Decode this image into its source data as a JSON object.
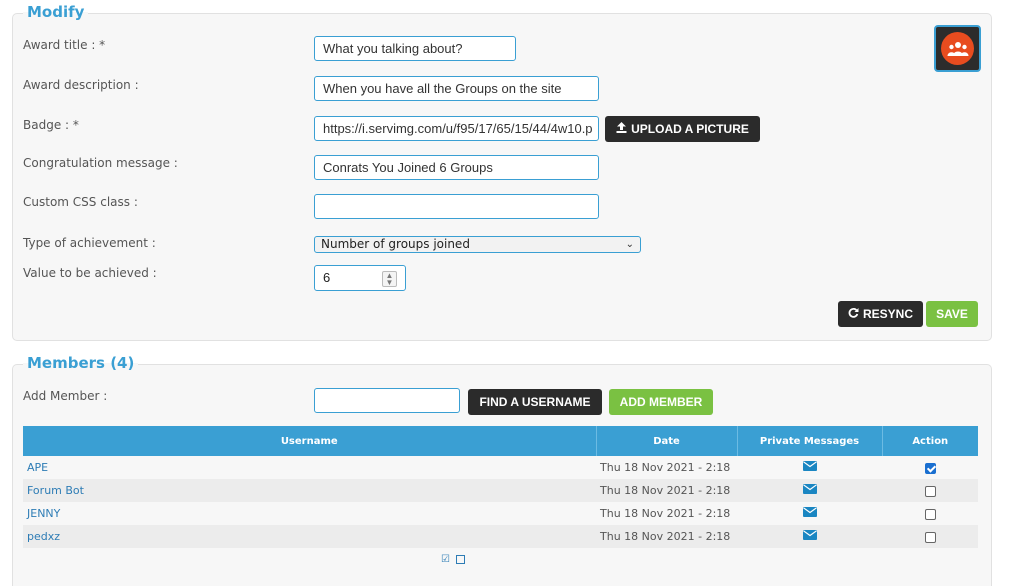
{
  "modify": {
    "legend": "Modify",
    "fields": {
      "award_title": {
        "label": "Award title : *",
        "value": "What you talking about?"
      },
      "award_description": {
        "label": "Award description :",
        "value": "When you have all the Groups on the site"
      },
      "badge": {
        "label": "Badge : *",
        "value": "https://i.servimg.com/u/f95/17/65/15/44/4w10.p"
      },
      "congratulation_message": {
        "label": "Congratulation message :",
        "value": "Conrats You Joined 6 Groups"
      },
      "custom_css_class": {
        "label": "Custom CSS class :",
        "value": ""
      },
      "type_of_achievement": {
        "label": "Type of achievement :",
        "value": "Number of groups joined"
      },
      "value_to_be_achieved": {
        "label": "Value to be achieved :",
        "value": "6"
      }
    },
    "upload_button": "UPLOAD A PICTURE",
    "resync_button": "RESYNC",
    "save_button": "SAVE",
    "badge_icon": "group-people-icon"
  },
  "members": {
    "legend": "Members (4)",
    "add_member_label": "Add Member :",
    "add_member_value": "",
    "find_username_button": "FIND A USERNAME",
    "add_member_button": "ADD MEMBER",
    "columns": {
      "username": "Username",
      "date": "Date",
      "private_messages": "Private Messages",
      "action": "Action"
    },
    "rows": [
      {
        "username": "APE",
        "date": "Thu 18 Nov 2021 - 2:18",
        "checked": true
      },
      {
        "username": "Forum Bot",
        "date": "Thu 18 Nov 2021 - 2:18",
        "checked": false
      },
      {
        "username": "JENNY",
        "date": "Thu 18 Nov 2021 - 2:18",
        "checked": false
      },
      {
        "username": "pedxz",
        "date": "Thu 18 Nov 2021 - 2:18",
        "checked": false
      }
    ],
    "pm_icon": "envelope-icon"
  },
  "colors": {
    "accent": "#3a9fd3",
    "dark_button": "#2b2b2b",
    "green_button": "#7ac142",
    "badge_orange": "#e84c1f"
  }
}
